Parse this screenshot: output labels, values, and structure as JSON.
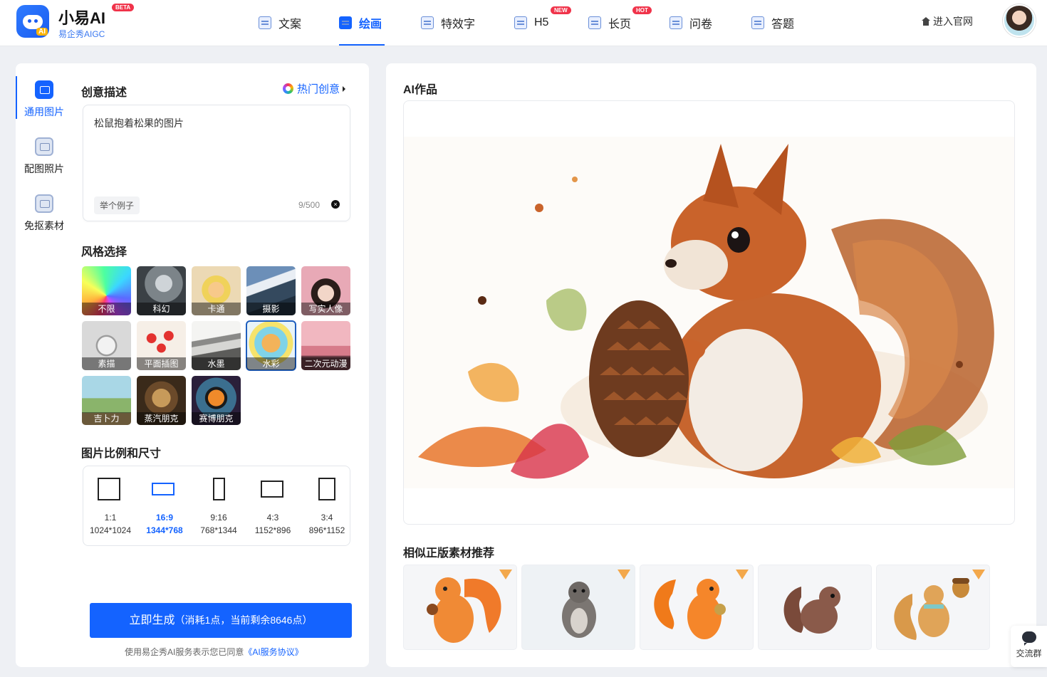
{
  "brand": {
    "name": "小易AI",
    "badge": "BETA",
    "subtitle": "易企秀AIGC",
    "logo_tag": "AI"
  },
  "nav": [
    {
      "label": "文案",
      "icon": "copywriting-icon",
      "tag": ""
    },
    {
      "label": "绘画",
      "icon": "painting-icon",
      "tag": "",
      "active": true
    },
    {
      "label": "特效字",
      "icon": "effect-text-icon",
      "tag": ""
    },
    {
      "label": "H5",
      "icon": "h5-icon",
      "tag": "NEW"
    },
    {
      "label": "长页",
      "icon": "long-page-icon",
      "tag": "HOT"
    },
    {
      "label": "问卷",
      "icon": "survey-icon",
      "tag": ""
    },
    {
      "label": "答题",
      "icon": "quiz-icon",
      "tag": ""
    }
  ],
  "header_right": {
    "official_site": "进入官网"
  },
  "side_tabs": [
    {
      "label": "通用图片",
      "icon": "image-icon",
      "active": true
    },
    {
      "label": "配图照片",
      "icon": "photo-icon"
    },
    {
      "label": "免抠素材",
      "icon": "cutout-icon"
    }
  ],
  "creative": {
    "title": "创意描述",
    "hot_link": "热门创意",
    "prompt": "松鼠抱着松果的图片",
    "example_button": "举个例子",
    "counter": "9/500"
  },
  "style_section": {
    "title": "风格选择",
    "styles": [
      {
        "label": "不限"
      },
      {
        "label": "科幻"
      },
      {
        "label": "卡通"
      },
      {
        "label": "摄影"
      },
      {
        "label": "写实人像"
      },
      {
        "label": "素描"
      },
      {
        "label": "平面插图"
      },
      {
        "label": "水墨"
      },
      {
        "label": "水彩",
        "selected": true
      },
      {
        "label": "二次元动漫"
      },
      {
        "label": "吉卜力"
      },
      {
        "label": "蒸汽朋克"
      },
      {
        "label": "赛博朋克"
      }
    ]
  },
  "ratio_section": {
    "title": "图片比例和尺寸",
    "options": [
      {
        "ratio": "1:1",
        "size": "1024*1024"
      },
      {
        "ratio": "16:9",
        "size": "1344*768",
        "active": true
      },
      {
        "ratio": "9:16",
        "size": "768*1344"
      },
      {
        "ratio": "4:3",
        "size": "1152*896"
      },
      {
        "ratio": "3:4",
        "size": "896*1152"
      }
    ]
  },
  "generate": {
    "label": "立即生成",
    "cost": "（消耗1点，当前剩余8646点）",
    "agreement_prefix": "使用易企秀AI服务表示您已同意",
    "agreement_link": "《AI服务协议》"
  },
  "works": {
    "title": "AI作品"
  },
  "recommend": {
    "title": "相似正版素材推荐",
    "count": 5
  },
  "chat": {
    "label": "交流群"
  },
  "colors": {
    "primary": "#1463ff",
    "tag_red": "#f0334a",
    "bg": "#eef0f4"
  }
}
